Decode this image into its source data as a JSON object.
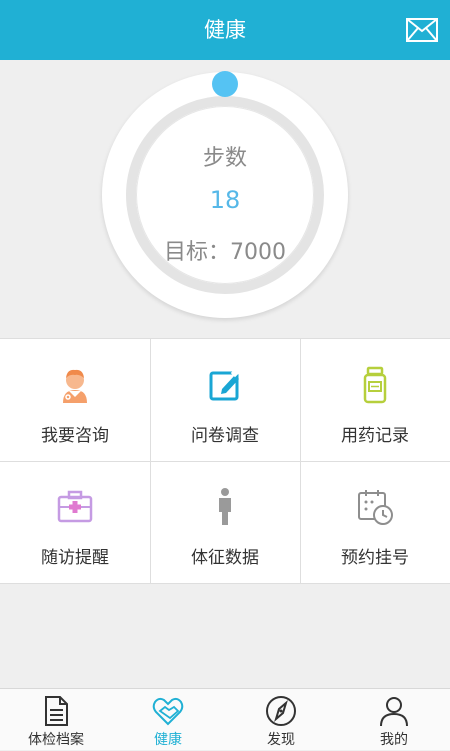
{
  "header": {
    "title": "健康",
    "mail_icon": "mail-icon"
  },
  "steps": {
    "label": "步数",
    "value": "18",
    "goal": "目标：7000",
    "progress_fraction": 0.0026
  },
  "grid": {
    "items": [
      {
        "label": "我要咨询",
        "icon": "doctor-icon"
      },
      {
        "label": "问卷调查",
        "icon": "edit-icon"
      },
      {
        "label": "用药记录",
        "icon": "medicine-bottle-icon"
      },
      {
        "label": "随访提醒",
        "icon": "medical-kit-icon"
      },
      {
        "label": "体征数据",
        "icon": "person-icon"
      },
      {
        "label": "预约挂号",
        "icon": "calendar-clock-icon"
      }
    ]
  },
  "tabs": [
    {
      "label": "体检档案",
      "icon": "document-icon",
      "active": false
    },
    {
      "label": "健康",
      "icon": "heart-handshake-icon",
      "active": true
    },
    {
      "label": "发现",
      "icon": "compass-icon",
      "active": false
    },
    {
      "label": "我的",
      "icon": "user-icon",
      "active": false
    }
  ],
  "colors": {
    "accent": "#20b0d4",
    "progress_dot": "#55c3f3",
    "background": "#efefef"
  }
}
